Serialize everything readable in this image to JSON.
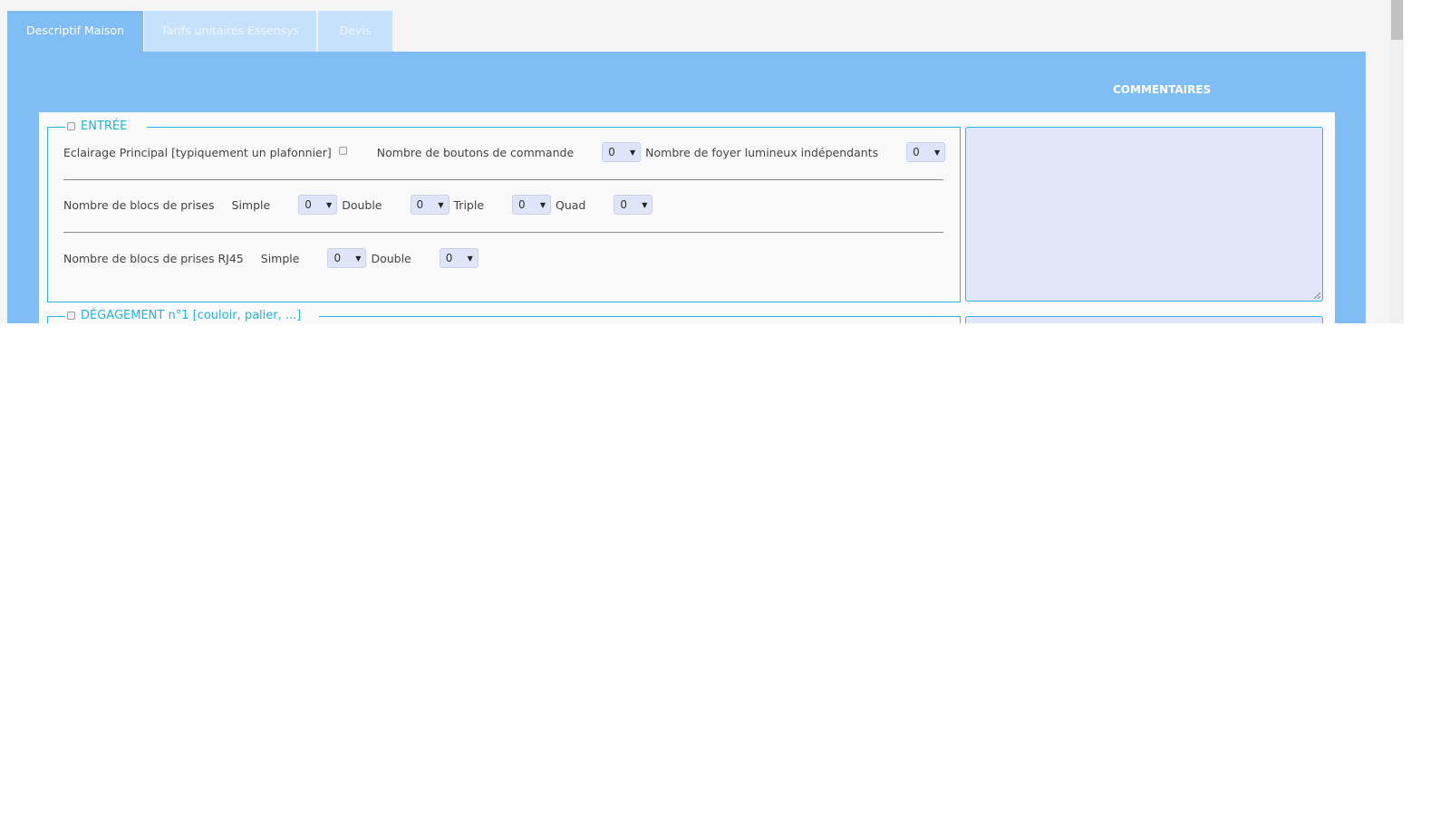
{
  "tabs": [
    {
      "label": "Descriptif Maison",
      "active": true
    },
    {
      "label": "Tarifs unitaires Essensys",
      "active": false
    },
    {
      "label": "Devis",
      "active": false
    }
  ],
  "comments_header": "COMMENTAIRES",
  "sections": [
    {
      "title": "ENTRÉE",
      "lighting": {
        "label": "Eclairage Principal [typiquement un plafonnier]",
        "buttons_label": "Nombre de boutons de commande",
        "buttons_value": "0",
        "foyers_label": "Nombre de foyer lumineux indépendants",
        "foyers_value": "0"
      },
      "outlets": {
        "label": "Nombre de blocs de prises",
        "simple_label": "Simple",
        "simple_value": "0",
        "double_label": "Double",
        "double_value": "0",
        "triple_label": "Triple",
        "triple_value": "0",
        "quad_label": "Quad",
        "quad_value": "0"
      },
      "rj45": {
        "label": "Nombre de blocs de prises RJ45",
        "simple_label": "Simple",
        "simple_value": "0",
        "double_label": "Double",
        "double_value": "0"
      },
      "comment": ""
    },
    {
      "title": "DÉGAGEMENT n°1 [couloir, palier, ...]",
      "comment": ""
    }
  ],
  "colors": {
    "tab_active": "#80bdf5",
    "tab_inactive": "#c6e1fb",
    "accent": "#1fb4dc",
    "field_bg": "#dfe5f8"
  }
}
